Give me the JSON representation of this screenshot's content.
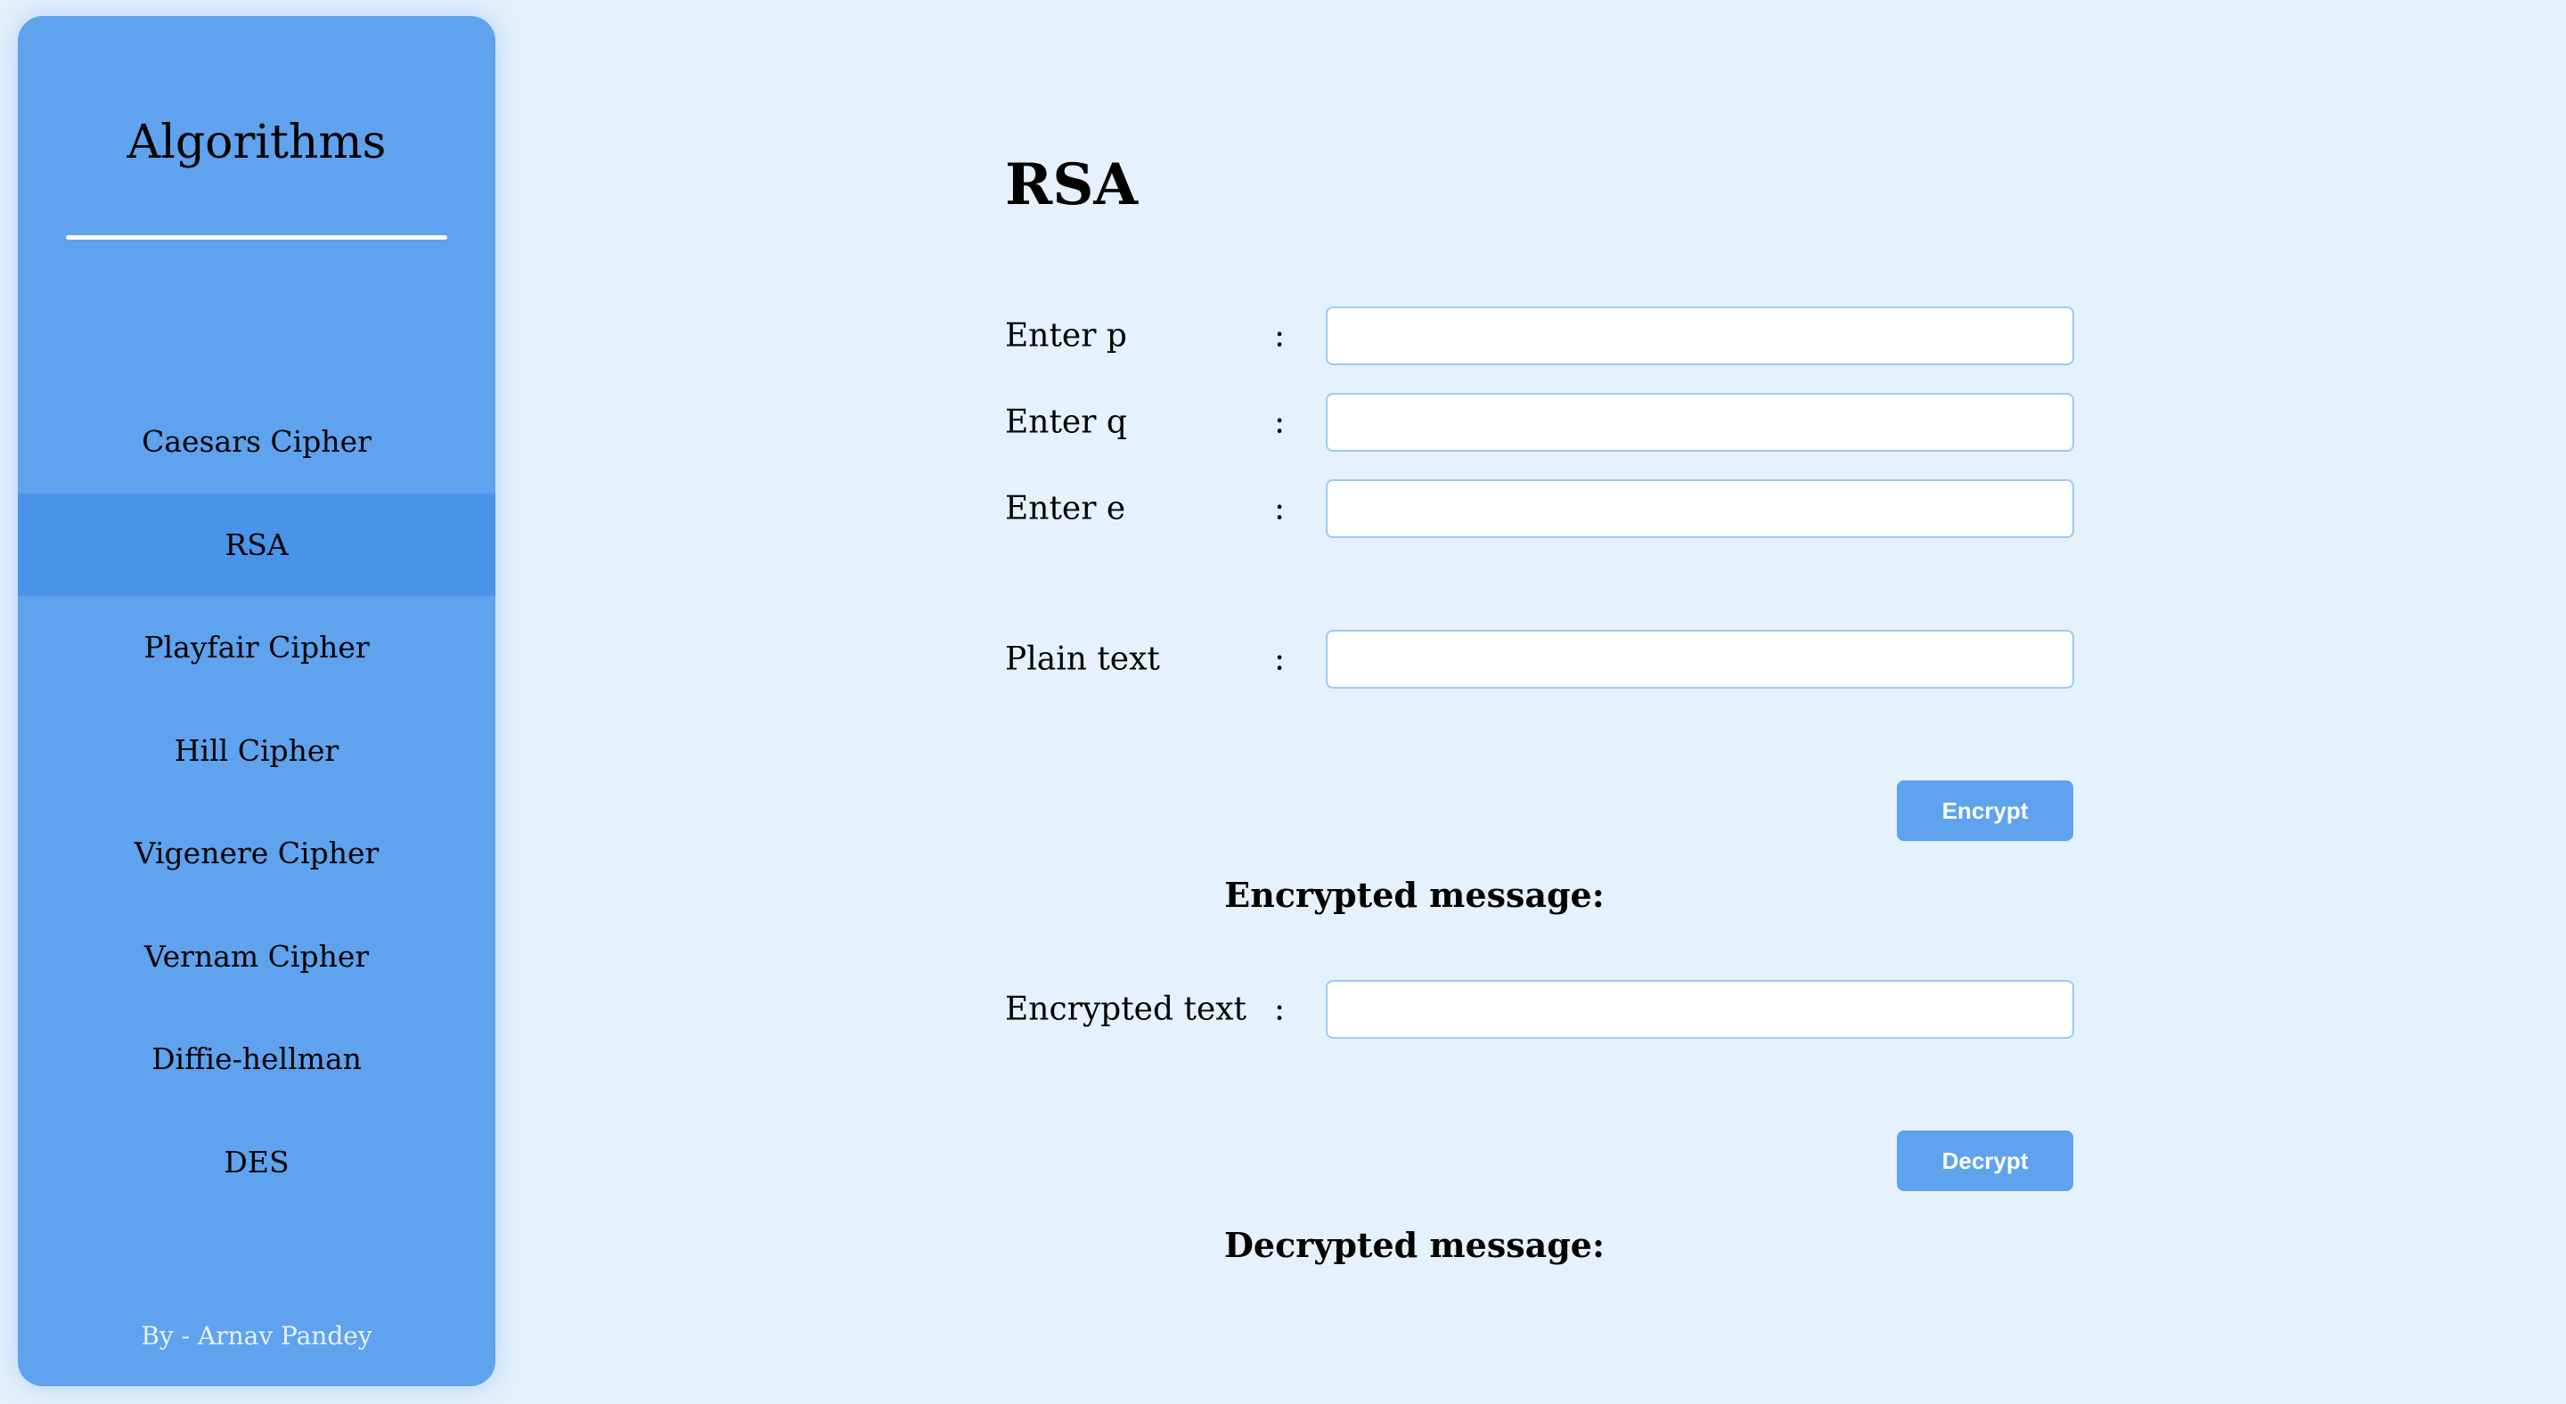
{
  "sidebar": {
    "title": "Algorithms",
    "items": [
      {
        "label": "Caesars Cipher",
        "active": false
      },
      {
        "label": "RSA",
        "active": true
      },
      {
        "label": "Playfair Cipher",
        "active": false
      },
      {
        "label": "Hill Cipher",
        "active": false
      },
      {
        "label": "Vigenere Cipher",
        "active": false
      },
      {
        "label": "Vernam Cipher",
        "active": false
      },
      {
        "label": "Diffie-hellman",
        "active": false
      },
      {
        "label": "DES",
        "active": false
      }
    ],
    "footer": "By - Arnav Pandey"
  },
  "main": {
    "title": "RSA",
    "colon": ":",
    "fields": {
      "p": {
        "label": "Enter p",
        "value": ""
      },
      "q": {
        "label": "Enter q",
        "value": ""
      },
      "e": {
        "label": "Enter e",
        "value": ""
      },
      "plain": {
        "label": "Plain text",
        "value": ""
      },
      "encrypted": {
        "label": "Encrypted text",
        "value": ""
      }
    },
    "encrypt_label": "Encrypt",
    "decrypt_label": "Decrypt",
    "encrypted_message_label": "Encrypted message:",
    "decrypted_message_label": "Decrypted message:"
  },
  "colors": {
    "background": "#e5f1fc",
    "sidebar": "#5fa2ee",
    "sidebar_active": "#4993ea",
    "button": "#5fa2ee",
    "input_border": "#9ec8f5"
  }
}
